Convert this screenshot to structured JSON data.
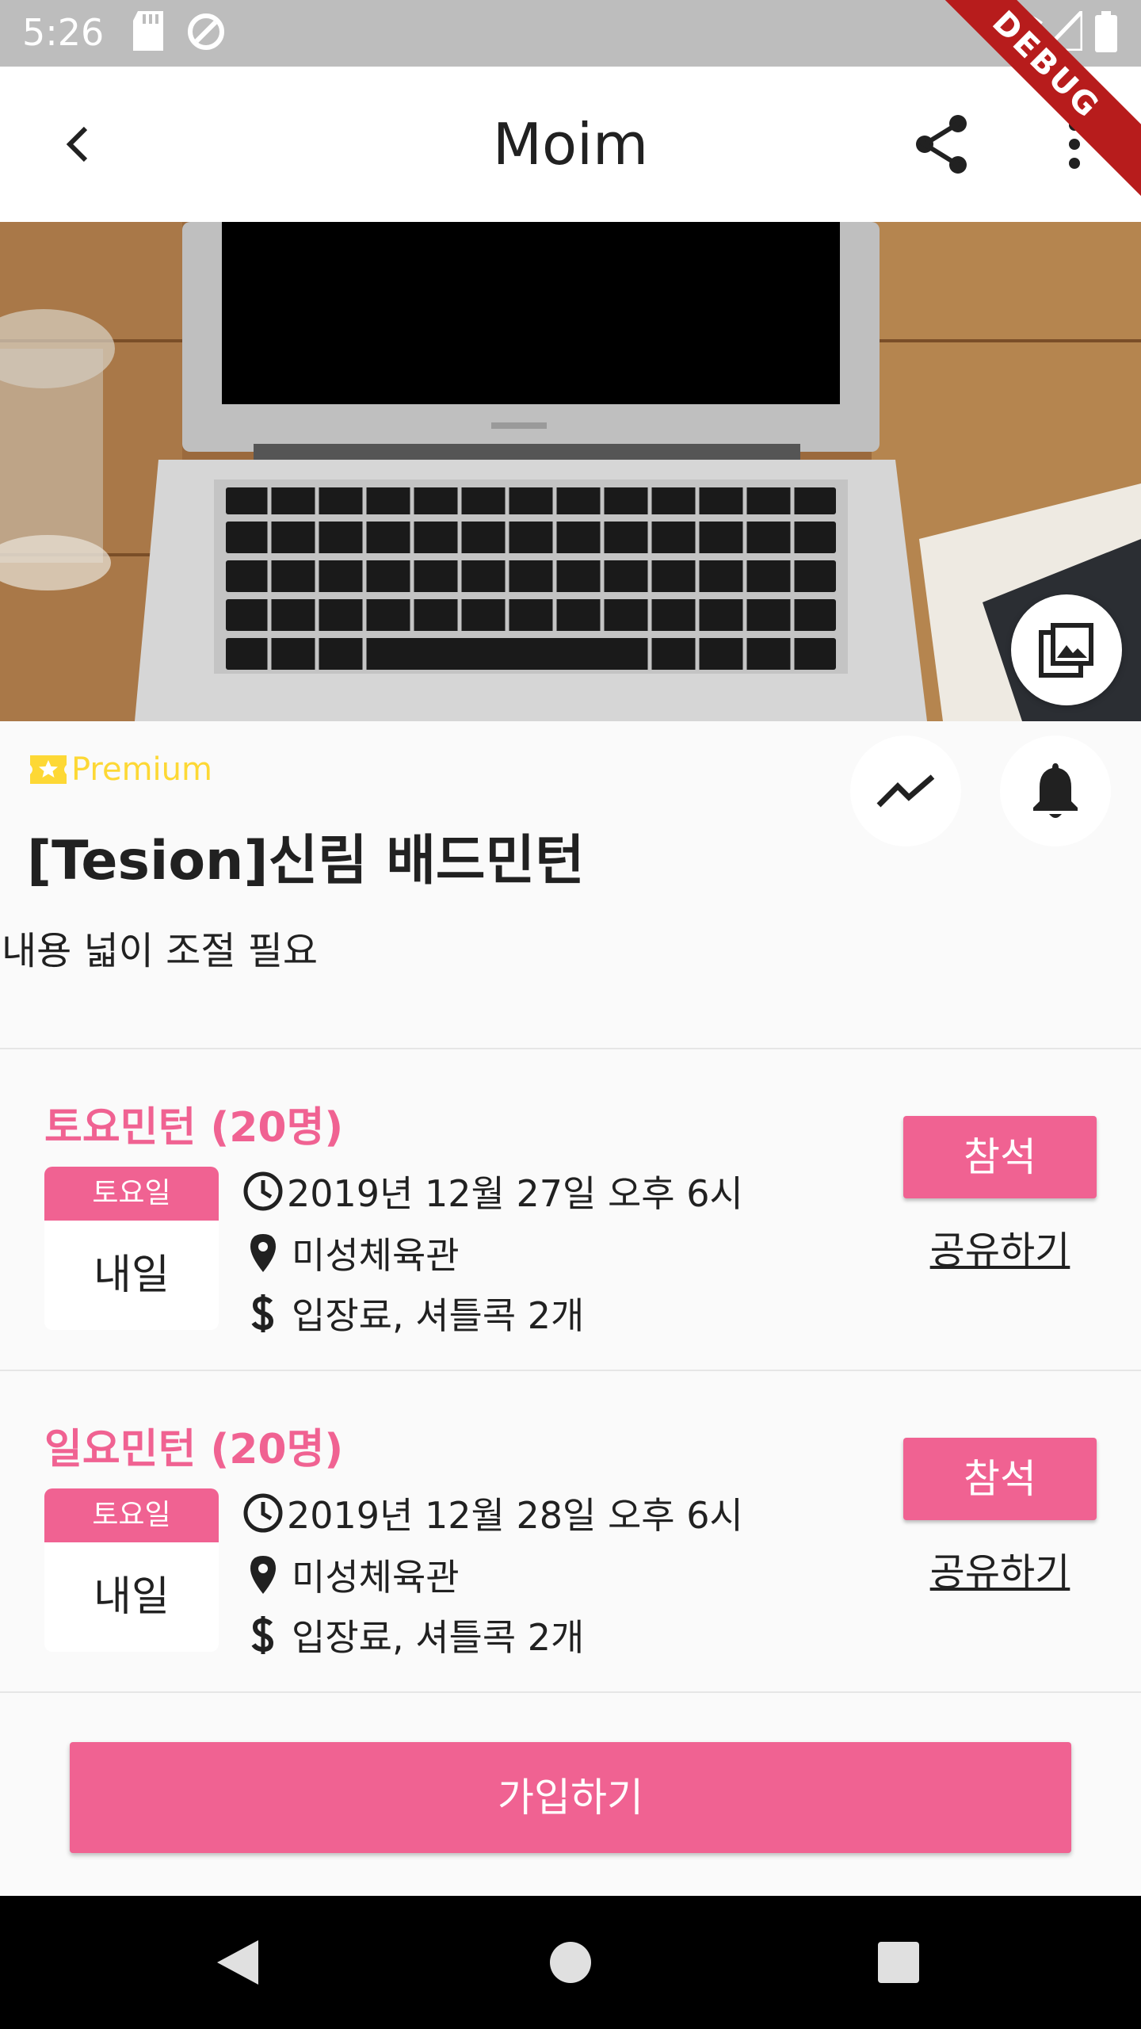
{
  "status_bar": {
    "time": "5:26",
    "debug_label": "DEBUG",
    "icons": [
      "sd-card-icon",
      "data-saver-icon",
      "wifi-icon",
      "signal-icon",
      "battery-icon"
    ]
  },
  "app_bar": {
    "title": "Moim",
    "icons": [
      "back-arrow-icon",
      "share-icon",
      "more-vert-icon"
    ]
  },
  "hero": {
    "icon": "photo-library-icon"
  },
  "group": {
    "badge": "Premium",
    "title": "[Tesion]신림 배드민턴",
    "description": "내용 넓이 조절 필요",
    "action_icons": [
      "trending-icon",
      "bell-icon"
    ]
  },
  "events": [
    {
      "title": "토요민턴  (20명)",
      "day_label": "토요일",
      "day_relative": "내일",
      "datetime": "2019년 12월 27일 오후 6시",
      "location": "미성체육관",
      "fee": "입장료, 셔틀콕 2개",
      "attend_label": "참석",
      "share_label": "공유하기"
    },
    {
      "title": "일요민턴  (20명)",
      "day_label": "토요일",
      "day_relative": "내일",
      "datetime": "2019년 12월 28일 오후 6시",
      "location": "미성체육관",
      "fee": "입장료, 셔틀콕 2개",
      "attend_label": "참석",
      "share_label": "공유하기"
    }
  ],
  "join_label": "가입하기",
  "colors": {
    "accent": "#f06292",
    "premium": "#fdd835",
    "status_bar": "#bdbdbd",
    "debug_ribbon": "#b71c1c"
  },
  "nav_icons": [
    "nav-back-icon",
    "nav-home-icon",
    "nav-recents-icon"
  ]
}
